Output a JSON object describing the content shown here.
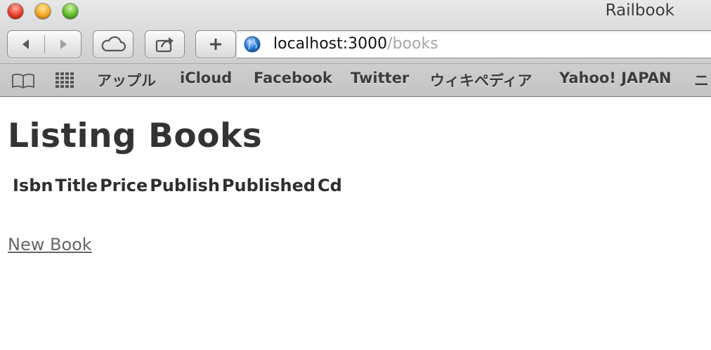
{
  "window": {
    "title": "Railbook"
  },
  "address_bar": {
    "host": "localhost:3000",
    "path": "/books"
  },
  "bookmarks": [
    {
      "label": "アップル"
    },
    {
      "label": "iCloud"
    },
    {
      "label": "Facebook"
    },
    {
      "label": "Twitter"
    },
    {
      "label": "ウィキペディア"
    },
    {
      "label": "Yahoo! JAPAN"
    },
    {
      "label": "ニ"
    }
  ],
  "page": {
    "heading": "Listing Books",
    "table": {
      "columns": [
        "Isbn",
        "Title",
        "Price",
        "Publish",
        "Published",
        "Cd"
      ]
    },
    "new_book_link": "New Book"
  },
  "icons": {
    "back": "back-arrow-icon",
    "forward": "forward-arrow-icon",
    "cloud": "cloud-icon",
    "share": "share-icon",
    "plus": "plus-icon",
    "globe": "globe-icon",
    "reading_list": "book-icon",
    "top_sites": "grid-icon"
  },
  "colors": {
    "link": "#666666",
    "heading": "#333333",
    "url_path": "#a7a7a7"
  }
}
